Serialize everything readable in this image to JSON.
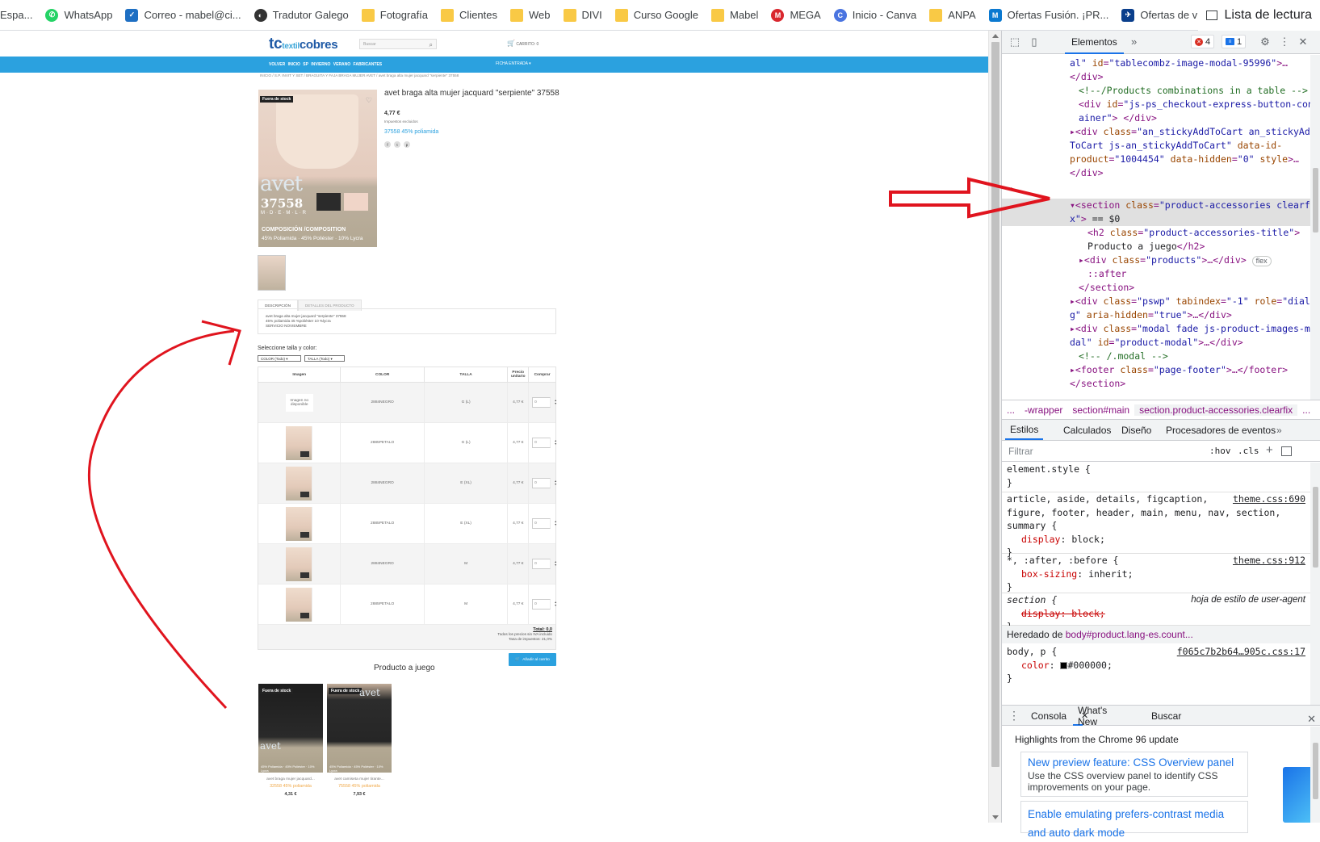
{
  "bookmarks": [
    {
      "label": "Espa...",
      "icon": "bookmark-icon"
    },
    {
      "label": "WhatsApp",
      "icon": "whatsapp-icon"
    },
    {
      "label": "Correo - mabel@ci...",
      "icon": "mail-icon"
    },
    {
      "label": "Tradutor Galego",
      "icon": "globe-icon"
    },
    {
      "label": "Fotografía",
      "icon": "folder-icon"
    },
    {
      "label": "Clientes",
      "icon": "folder-icon"
    },
    {
      "label": "Web",
      "icon": "folder-icon"
    },
    {
      "label": "DIVI",
      "icon": "folder-icon"
    },
    {
      "label": "Curso Google",
      "icon": "folder-icon"
    },
    {
      "label": "Mabel",
      "icon": "folder-icon"
    },
    {
      "label": "MEGA",
      "icon": "mega-icon"
    },
    {
      "label": "Inicio - Canva",
      "icon": "canva-icon"
    },
    {
      "label": "ANPA",
      "icon": "folder-icon"
    },
    {
      "label": "Ofertas Fusión. ¡PR...",
      "icon": "movistar-icon"
    },
    {
      "label": "Ofertas de viajes, y...",
      "icon": "travel-icon"
    }
  ],
  "reading_list": "Lista de lectura",
  "site": {
    "logo_tc": "tc",
    "logo_textil": "textil",
    "logo_cobres": "cobres",
    "search_placeholder": "Buscar",
    "cart": "CARRITO: 0",
    "nav_items": "VOLVER  INICIO  SP  INVIERNO  VERANO  FABRICANTES",
    "nav_right": "FICHA ENTRADA ▾",
    "breadcrumb": "INICIO  /  S.P. INVIT Y SET  /  BRAGUITA Y FAJA BRAGA MUJER AVET  /  avet braga alta mujer jacquard \"serpiente\" 37558",
    "out_of_stock": "Fuera de stock",
    "product_image": {
      "brand": "avet",
      "number": "37558",
      "sizes": "M·D·E·M·L·R",
      "composition_title": "COMPOSICIÓN /COMPOSITION",
      "composition": "45% Poliamida · 45% Poliéster · 10% Lycra"
    },
    "product_title": "avet braga alta mujer jacquard \"serpiente\" 37558",
    "price": "4,77 €",
    "tax_note": "Impuestos excluidos",
    "polyamide": "37558 45% poliamida",
    "share": [
      "f",
      "t",
      "p"
    ],
    "tabs": [
      "DESCRIPCIÓN",
      "DETALLES DEL PRODUCTO"
    ],
    "description": [
      "avet braga alta mujer jacquard \"serpiente\" 37558",
      "45% poliamida 45 %poliéster 10 %lycra",
      "SERVICIO NOVIEMBRE"
    ],
    "select_label": "Seleccione talla y color:",
    "select_color": "COLOR (Todo)",
    "select_size": "TALLA (Todo)",
    "table_headers": [
      "Imagen",
      "COLOR",
      "TALLA",
      "Precio unitario",
      "Comprar"
    ],
    "table_rows": [
      {
        "image": "Imagen no disponible",
        "color": "2884NEGRO",
        "size": "G (L)",
        "price": "4,77 €",
        "qty": "0"
      },
      {
        "image": "",
        "color": "2885PETALO",
        "size": "G (L)",
        "price": "4,77 €",
        "qty": "0"
      },
      {
        "image": "",
        "color": "2884NEGRO",
        "size": "E (XL)",
        "price": "4,77 €",
        "qty": "0"
      },
      {
        "image": "",
        "color": "2885PETALO",
        "size": "E (XL)",
        "price": "4,77 €",
        "qty": "0"
      },
      {
        "image": "",
        "color": "2884NEGRO",
        "size": "M",
        "price": "4,77 €",
        "qty": "0"
      },
      {
        "image": "",
        "color": "2885PETALO",
        "size": "M",
        "price": "4,77 €",
        "qty": "0"
      }
    ],
    "total": "Total: 0,0",
    "total_note1": "Todos los precios sin IVA incluido",
    "total_note2": "Tasa de impuestos: 21,0%",
    "add_to_cart": "Añadir al carrito",
    "related_title": "Producto a juego",
    "related": [
      {
        "name": "avet braga mujer jacquard...",
        "poly": "32558 45% poliamida",
        "price": "4,31 €",
        "brand": "avet",
        "small": "45% Poliamida · 45% Poliéster · 10% Lycra"
      },
      {
        "name": "avet camiseta mujer tirante...",
        "poly": "75558 45% poliamida",
        "price": "7,93 €",
        "brand": "avet",
        "small": "45% Poliamida · 45% Poliéster · 10% Lycra"
      }
    ]
  },
  "devtools": {
    "tab": "Elementos",
    "errors": "4",
    "messages": "1",
    "breadcrumb": [
      "...",
      "-wrapper",
      "section#main",
      "section.product-accessories.clearfix",
      "..."
    ],
    "styles_tabs": [
      "Estilos",
      "Calculados",
      "Diseño",
      "Procesadores de eventos"
    ],
    "filter_placeholder": "Filtrar",
    "hov": ":hov",
    "cls": ".cls",
    "inherited_label": "Heredado de",
    "inherited_from": "body#product.lang-es.count...",
    "drawer_tabs": [
      "Consola",
      "What's New",
      "Buscar"
    ],
    "whatsnew_header": "Highlights from the Chrome 96 update",
    "cards": [
      {
        "title": "New preview feature: CSS Overview panel",
        "body": "Use the CSS overview panel to identify CSS improvements on your page."
      },
      {
        "title": "Enable emulating prefers-contrast media and auto dark mode",
        "body": ""
      }
    ]
  }
}
